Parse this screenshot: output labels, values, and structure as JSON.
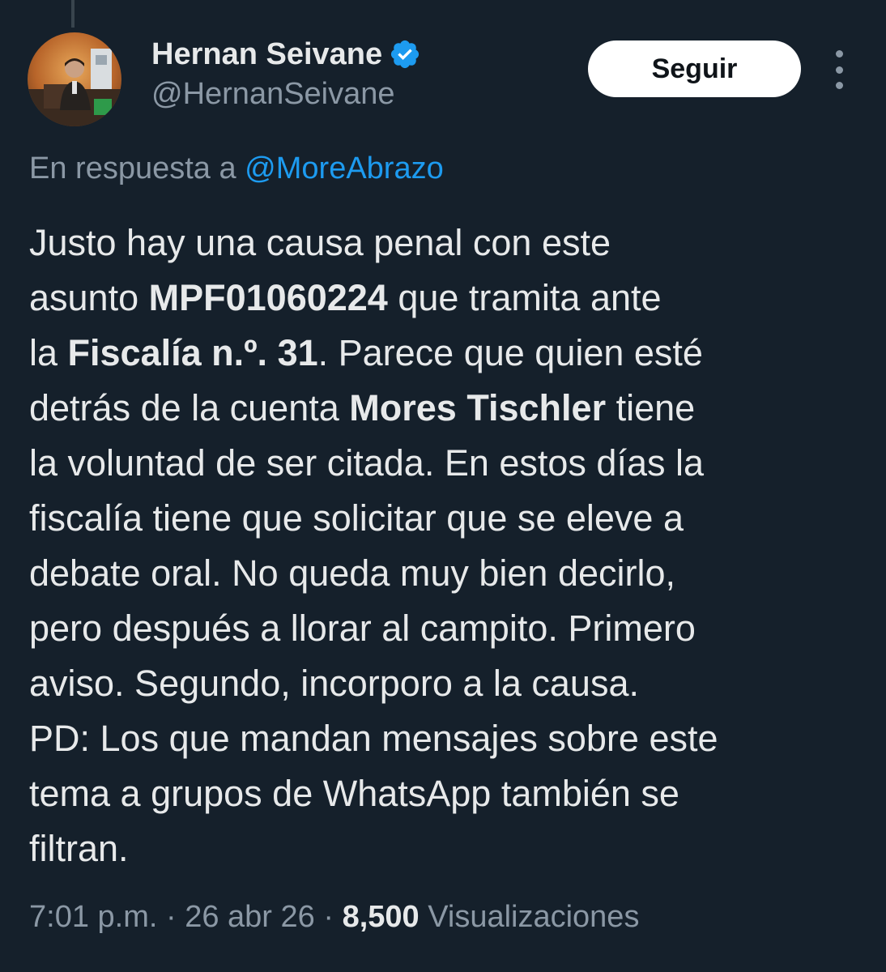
{
  "author": {
    "display_name": "Hernan Seivane",
    "handle": "@HernanSeivane",
    "verified": true
  },
  "follow_button_label": "Seguir",
  "reply_context": {
    "prefix": "En respuesta a",
    "mention": "@MoreAbrazo"
  },
  "tweet": {
    "lines": [
      [
        {
          "t": "Justo hay una causa penal con este"
        }
      ],
      [
        {
          "t": "asunto "
        },
        {
          "t": "MPF01060224",
          "b": true
        },
        {
          "t": " que tramita ante"
        }
      ],
      [
        {
          "t": "la "
        },
        {
          "t": "Fiscalía n.º. 31",
          "b": true
        },
        {
          "t": ". Parece que quien esté"
        }
      ],
      [
        {
          "t": "detrás de la cuenta "
        },
        {
          "t": "Mores Tischler",
          "b": true
        },
        {
          "t": " tiene"
        }
      ],
      [
        {
          "t": "la voluntad de ser citada. En estos días la"
        }
      ],
      [
        {
          "t": "fiscalía tiene que solicitar que se eleve a"
        }
      ],
      [
        {
          "t": "debate oral. No queda muy bien decirlo,"
        }
      ],
      [
        {
          "t": "pero después a llorar al campito. Primero"
        }
      ],
      [
        {
          "t": "aviso. Segundo, incorporo a la causa."
        }
      ],
      [
        {
          "t": "PD: Los que mandan mensajes sobre este"
        }
      ],
      [
        {
          "t": "tema a grupos de WhatsApp también se"
        }
      ],
      [
        {
          "t": "filtran."
        }
      ]
    ]
  },
  "meta": {
    "time": "7:01 p.m.",
    "separator": " · ",
    "date": "26 abr 26",
    "views_count": "8,500",
    "views_label": " Visualizaciones"
  },
  "colors": {
    "background": "#15202b",
    "text_primary": "#e7e9ea",
    "text_secondary": "#8b98a5",
    "link": "#1d9bf0",
    "verified_badge": "#1d9bf0"
  },
  "icons": {
    "verified": "verified-badge-icon",
    "more": "more-options-icon"
  }
}
